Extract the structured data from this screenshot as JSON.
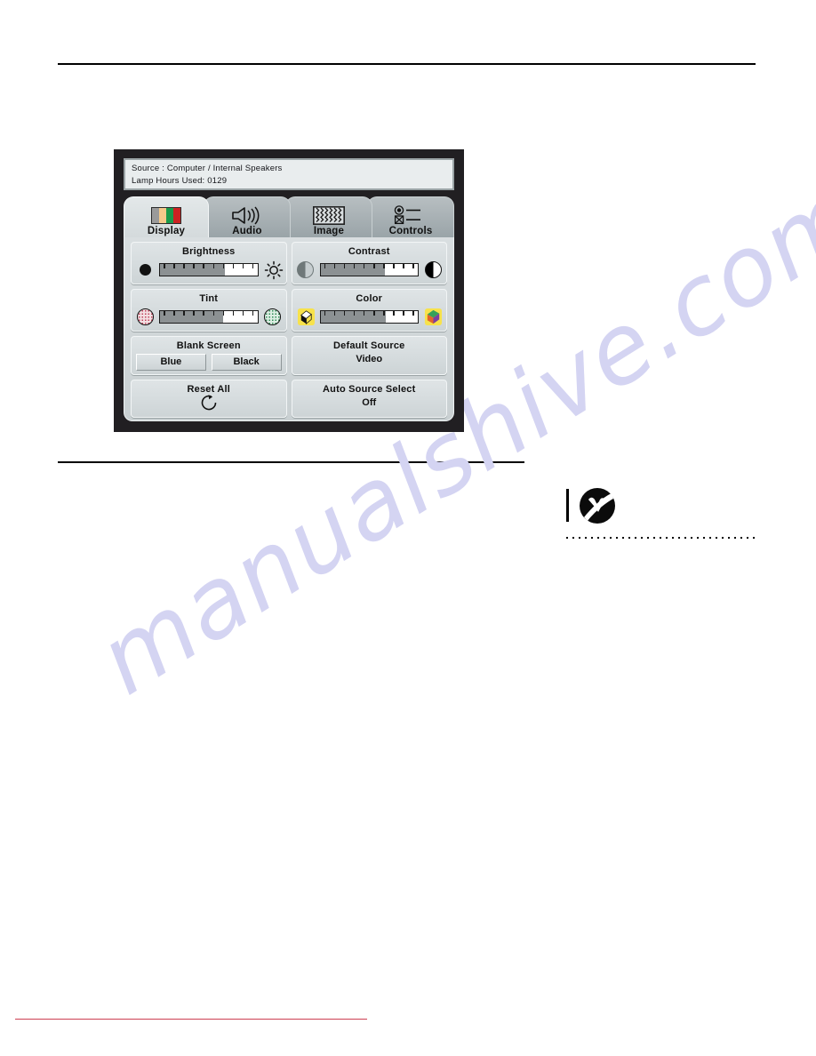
{
  "page": {
    "watermark_text": "manualshive.com"
  },
  "osd": {
    "status": {
      "source_line": "Source : Computer / Internal Speakers",
      "lamp_line": "Lamp Hours Used: 0129"
    },
    "tabs": [
      {
        "label": "Display",
        "icon": "color-bars-icon",
        "active": true
      },
      {
        "label": "Audio",
        "icon": "speaker-icon",
        "active": false
      },
      {
        "label": "Image",
        "icon": "zigzag-pattern-icon",
        "active": false
      },
      {
        "label": "Controls",
        "icon": "radio-checkbox-list-icon",
        "active": false
      }
    ],
    "sliders": [
      {
        "title": "Brightness",
        "left_icon": "black-dot-icon",
        "right_icon": "sun-icon",
        "fill_percent": 67
      },
      {
        "title": "Contrast",
        "left_icon": "half-circle-gray-icon",
        "right_icon": "half-circle-black-white-icon",
        "fill_percent": 66
      },
      {
        "title": "Tint",
        "left_icon": "pink-dotted-circle-icon",
        "right_icon": "green-dotted-circle-icon",
        "fill_percent": 65
      },
      {
        "title": "Color",
        "left_icon": "monochrome-cube-icon",
        "right_icon": "color-cube-icon",
        "fill_percent": 67
      }
    ],
    "blank_screen": {
      "title": "Blank Screen",
      "options": [
        "Blue",
        "Black"
      ]
    },
    "default_source": {
      "title": "Default Source",
      "value": "Video"
    },
    "reset_all": {
      "title": "Reset All",
      "icon": "reset-circular-arrow-icon"
    },
    "auto_source_select": {
      "title": "Auto Source Select",
      "value": "Off"
    },
    "display_icon_bars": [
      "#9a9a9a",
      "#f5c98a",
      "#1a9a4a",
      "#cc2222"
    ]
  },
  "colors": {
    "panel_frame": "#211f22",
    "panel_face": "#d3d9db",
    "tab_active": "#dde3e5",
    "tab_inactive": "#a7b0b4",
    "rule_black": "#000000",
    "rule_red": "#cc3f52",
    "watermark": "#d4d4f2",
    "slider_fill": "#8c9193"
  }
}
